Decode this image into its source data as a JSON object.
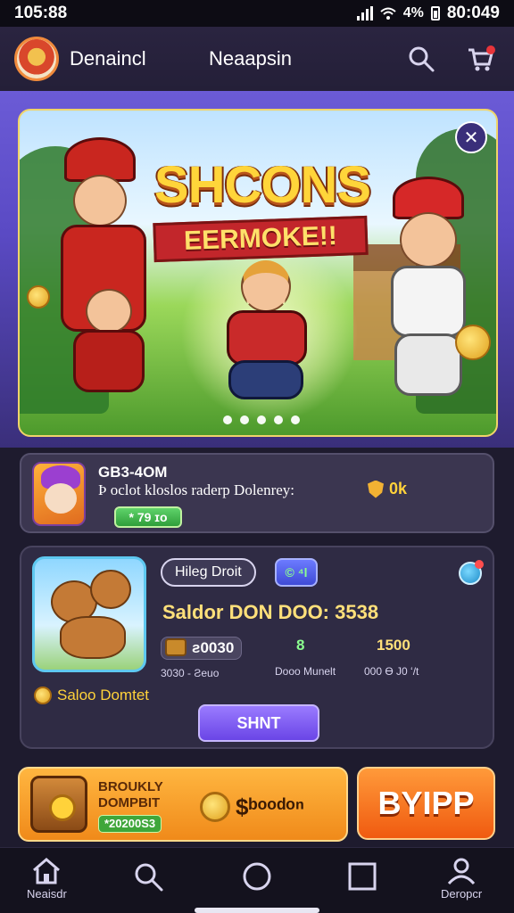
{
  "status_bar": {
    "left_time": "105:88",
    "battery_text": "4%",
    "clock": "80:049"
  },
  "header": {
    "brand": "Denaincl",
    "title": "Neaapsin",
    "icons": [
      "search-icon",
      "cart-icon"
    ]
  },
  "hero": {
    "title": "SHCONS",
    "subtitle": "EERMOKE!!",
    "close_icon": "close-icon",
    "slide_count": 5
  },
  "card1": {
    "code": "GB3-4OM",
    "description": "Þ oclot kloslos raderp Dolenrey:",
    "reward": "0k",
    "tag": "* 79 ɪo"
  },
  "card2": {
    "pill_label": "Hileg Droit",
    "pill_badge": "© ⁴l",
    "headline": "Saldor DON DOO: 3538",
    "stats": [
      {
        "value": "ƨ0030",
        "label": "3030 - Ƨeuo"
      },
      {
        "value": "8",
        "label": "Dooo Munelt"
      },
      {
        "value": "1500",
        "label": "000 Ɵ J0 ʻ/t"
      }
    ],
    "footer_label": "Saloo Domtet",
    "button": "SHNT"
  },
  "promo": {
    "line1": "BROUKLY",
    "line2": "DOMPBIT",
    "badge": "*20200S3",
    "price": "$ᵇᵒᵒᵈᵒⁿ"
  },
  "buy_button": "BYIPP",
  "bottom_nav": {
    "items": [
      {
        "label": "Neaisdr",
        "icon": "home-icon"
      },
      {
        "label": "",
        "icon": "search-icon"
      },
      {
        "label": "",
        "icon": "circle-icon"
      },
      {
        "label": "",
        "icon": "square-icon"
      },
      {
        "label": "Deropcr",
        "icon": "profile-icon"
      }
    ]
  },
  "colors": {
    "background": "#1e1b2e",
    "accent_orange": "#f08a1a",
    "accent_purple": "#6a45e6",
    "gold": "#ffd23a"
  }
}
